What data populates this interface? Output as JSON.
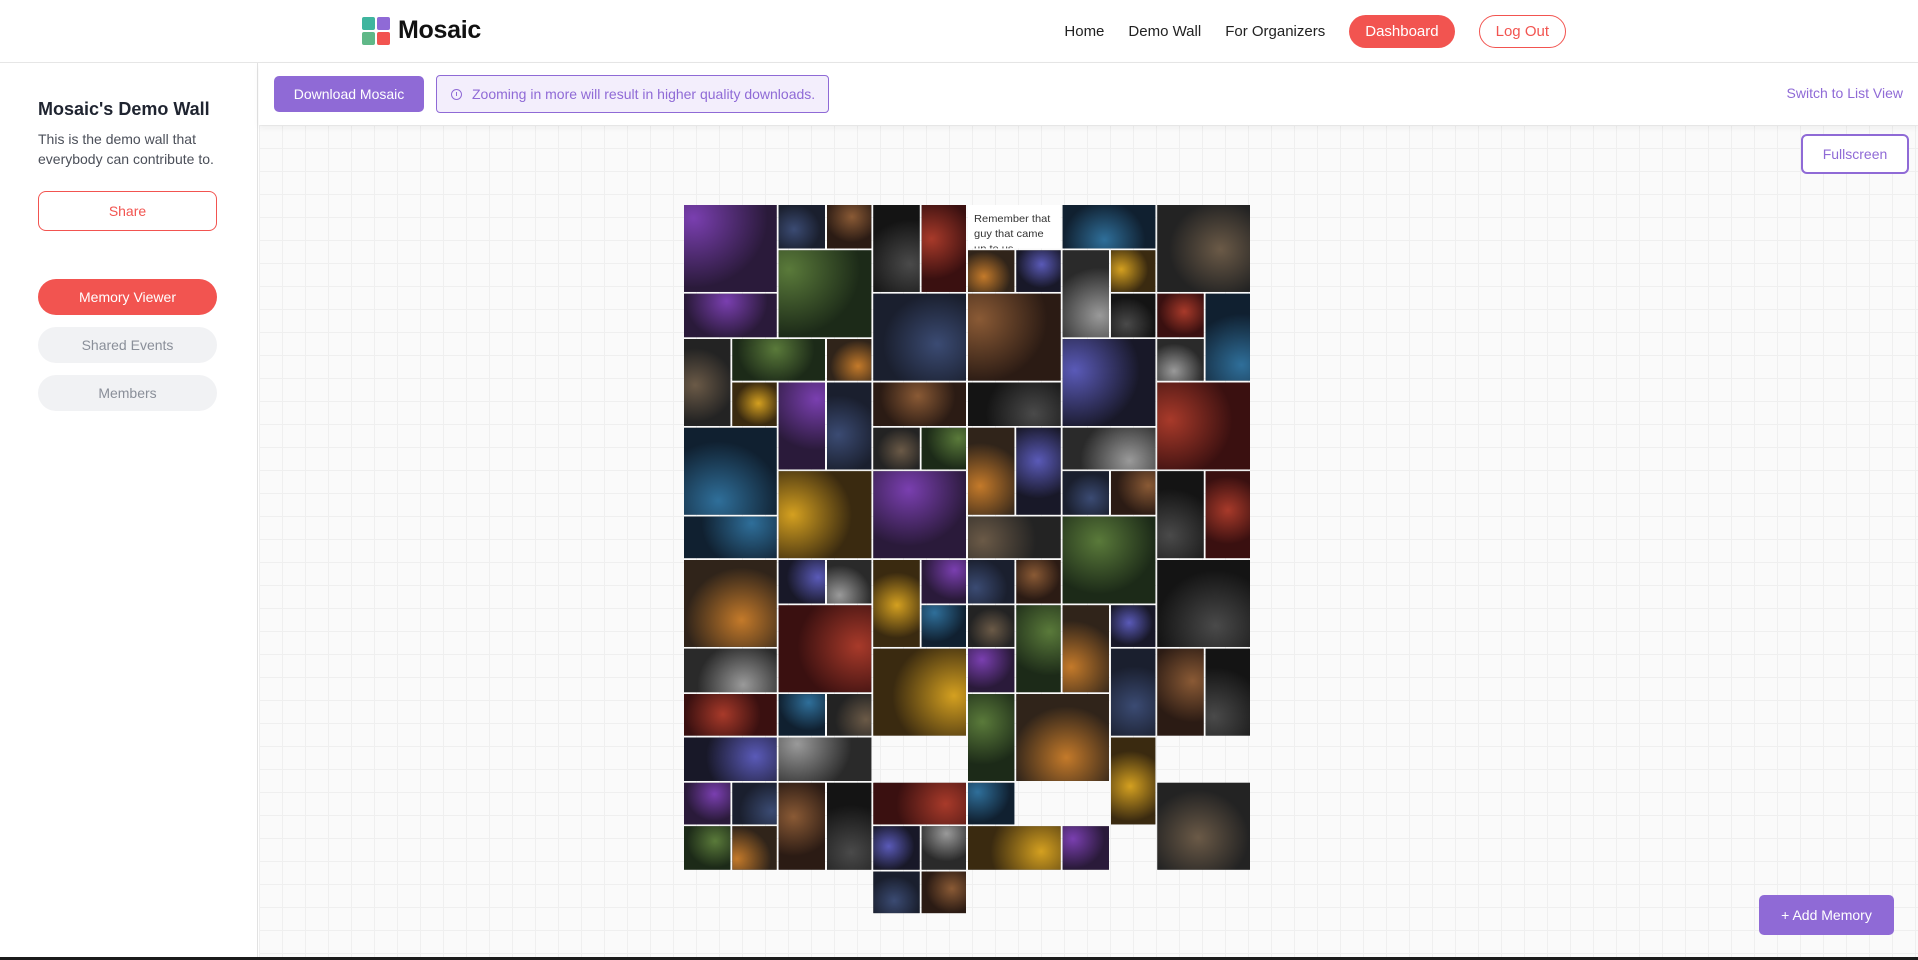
{
  "navbar": {
    "brand": "Mosaic",
    "logo_colors": [
      "#3fb59e",
      "#8f6ad6",
      "#60b888",
      "#f25450"
    ],
    "links": [
      "Home",
      "Demo Wall",
      "For Organizers"
    ],
    "dashboard_label": "Dashboard",
    "logout_label": "Log Out"
  },
  "sidebar": {
    "title": "Mosaic's Demo Wall",
    "description": "This is the demo wall that everybody can contribute to.",
    "share_label": "Share",
    "items": [
      {
        "label": "Memory Viewer",
        "active": true
      },
      {
        "label": "Shared Events",
        "active": false
      },
      {
        "label": "Members",
        "active": false
      }
    ]
  },
  "toolbar": {
    "download_label": "Download Mosaic",
    "hint_text": "Zooming in more will result in higher quality downloads.",
    "switch_label": "Switch to List View"
  },
  "canvas": {
    "fullscreen_label": "Fullscreen",
    "add_label": "+ Add Memory",
    "note_text": "Remember that guy that came up to us drunk?? That was so funny. Dude really thought I was dating my sister lmao"
  },
  "colors": {
    "accent_red": "#f25450",
    "accent_purple": "#8f6ad6"
  }
}
